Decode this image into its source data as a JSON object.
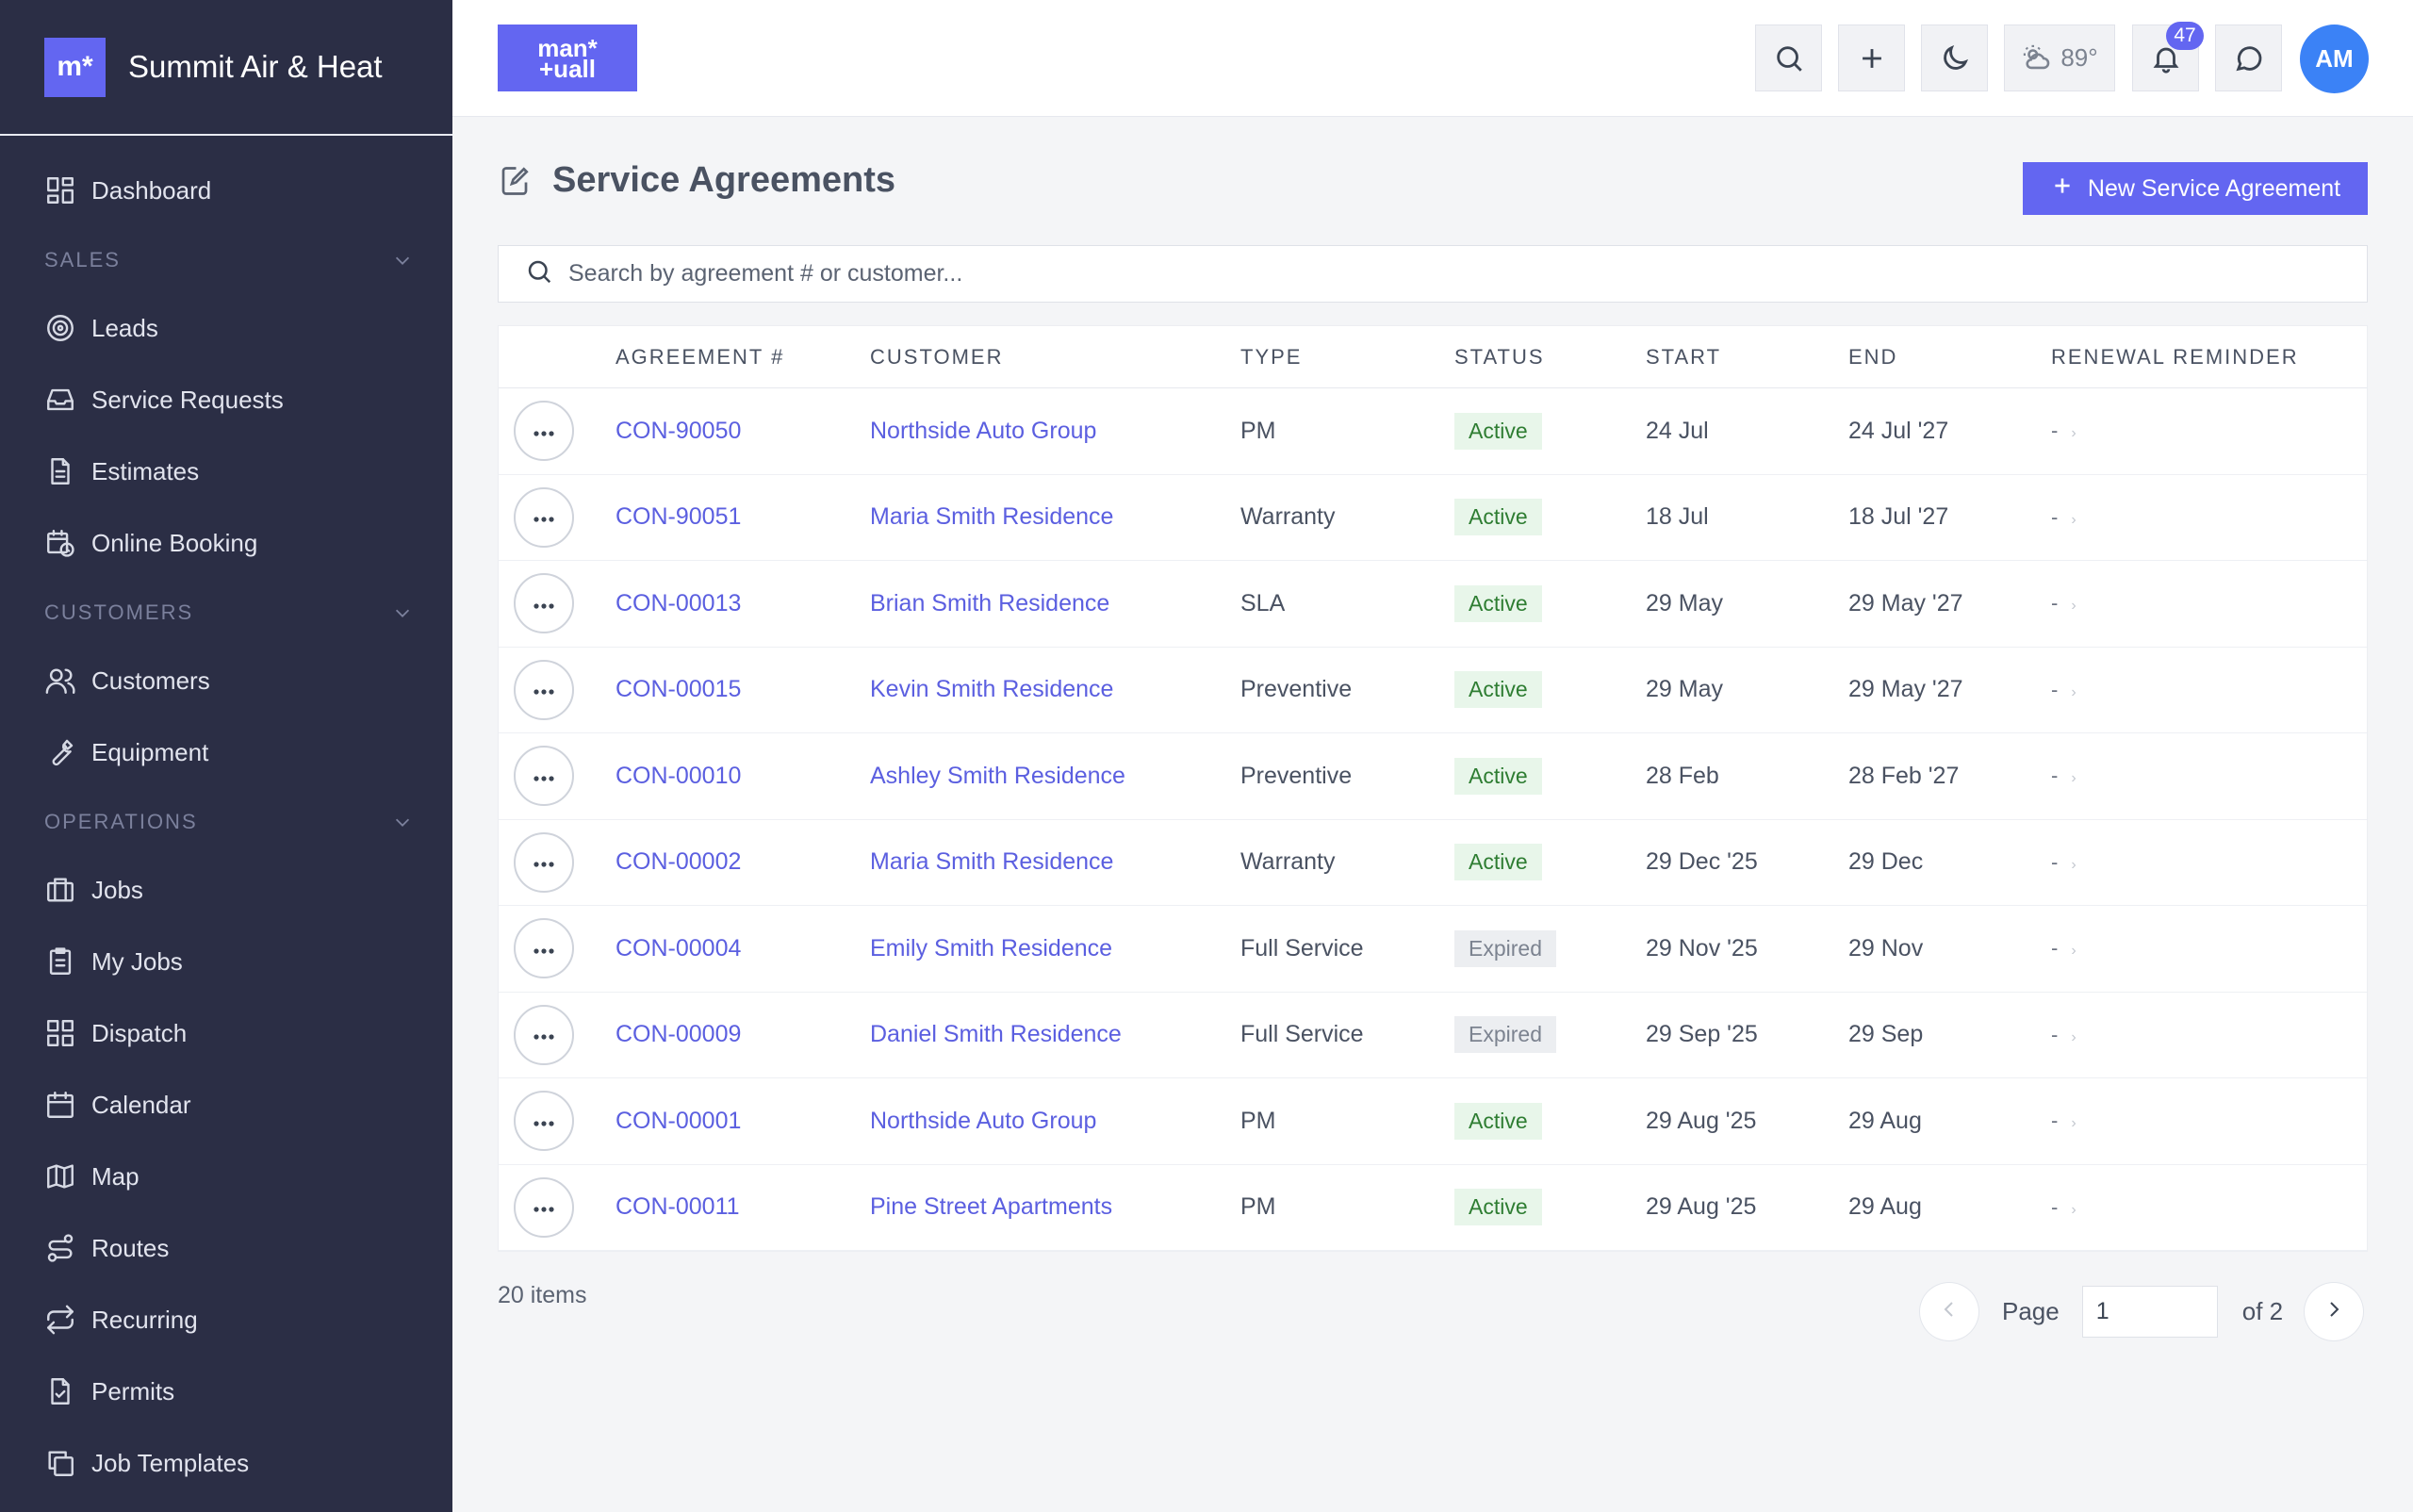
{
  "brand": {
    "logo": "m*",
    "name": "Summit Air & Heat"
  },
  "sidebar": {
    "top": [
      {
        "label": "Dashboard",
        "icon": "dashboard-icon"
      }
    ],
    "sections": [
      {
        "title": "SALES",
        "items": [
          {
            "label": "Leads",
            "icon": "target-icon"
          },
          {
            "label": "Service Requests",
            "icon": "inbox-icon"
          },
          {
            "label": "Estimates",
            "icon": "document-icon"
          },
          {
            "label": "Online Booking",
            "icon": "calendar-clock-icon"
          }
        ]
      },
      {
        "title": "CUSTOMERS",
        "items": [
          {
            "label": "Customers",
            "icon": "users-icon"
          },
          {
            "label": "Equipment",
            "icon": "wrench-icon"
          }
        ]
      },
      {
        "title": "OPERATIONS",
        "items": [
          {
            "label": "Jobs",
            "icon": "briefcase-icon"
          },
          {
            "label": "My Jobs",
            "icon": "clipboard-icon"
          },
          {
            "label": "Dispatch",
            "icon": "grid-icon"
          },
          {
            "label": "Calendar",
            "icon": "calendar-icon"
          },
          {
            "label": "Map",
            "icon": "map-icon"
          },
          {
            "label": "Routes",
            "icon": "route-icon"
          },
          {
            "label": "Recurring",
            "icon": "repeat-icon"
          },
          {
            "label": "Permits",
            "icon": "file-check-icon"
          },
          {
            "label": "Job Templates",
            "icon": "copy-icon"
          }
        ]
      }
    ]
  },
  "header": {
    "logo": "man*\n+uall",
    "weather": "89°",
    "notifications_count": "47",
    "avatar_initials": "AM"
  },
  "page": {
    "title": "Service Agreements",
    "new_button": "New Service Agreement",
    "search_placeholder": "Search by agreement # or customer..."
  },
  "table": {
    "columns": [
      "AGREEMENT #",
      "CUSTOMER",
      "TYPE",
      "STATUS",
      "START",
      "END",
      "RENEWAL REMINDER"
    ],
    "rows": [
      {
        "id": "CON-90050",
        "customer": "Northside Auto Group",
        "type": "PM",
        "status": "Active",
        "start": "24 Jul",
        "end": "24 Jul '27",
        "reminder": "-"
      },
      {
        "id": "CON-90051",
        "customer": "Maria Smith Residence",
        "type": "Warranty",
        "status": "Active",
        "start": "18 Jul",
        "end": "18 Jul '27",
        "reminder": "-"
      },
      {
        "id": "CON-00013",
        "customer": "Brian Smith Residence",
        "type": "SLA",
        "status": "Active",
        "start": "29 May",
        "end": "29 May '27",
        "reminder": "-"
      },
      {
        "id": "CON-00015",
        "customer": "Kevin Smith Residence",
        "type": "Preventive",
        "status": "Active",
        "start": "29 May",
        "end": "29 May '27",
        "reminder": "-"
      },
      {
        "id": "CON-00010",
        "customer": "Ashley Smith Residence",
        "type": "Preventive",
        "status": "Active",
        "start": "28 Feb",
        "end": "28 Feb '27",
        "reminder": "-"
      },
      {
        "id": "CON-00002",
        "customer": "Maria Smith Residence",
        "type": "Warranty",
        "status": "Active",
        "start": "29 Dec '25",
        "end": "29 Dec",
        "reminder": "-"
      },
      {
        "id": "CON-00004",
        "customer": "Emily Smith Residence",
        "type": "Full Service",
        "status": "Expired",
        "start": "29 Nov '25",
        "end": "29 Nov",
        "reminder": "-"
      },
      {
        "id": "CON-00009",
        "customer": "Daniel Smith Residence",
        "type": "Full Service",
        "status": "Expired",
        "start": "29 Sep '25",
        "end": "29 Sep",
        "reminder": "-"
      },
      {
        "id": "CON-00001",
        "customer": "Northside Auto Group",
        "type": "PM",
        "status": "Active",
        "start": "29 Aug '25",
        "end": "29 Aug",
        "reminder": "-"
      },
      {
        "id": "CON-00011",
        "customer": "Pine Street Apartments",
        "type": "PM",
        "status": "Active",
        "start": "29 Aug '25",
        "end": "29 Aug",
        "reminder": "-"
      }
    ]
  },
  "footer": {
    "items_count": "20 items",
    "page_label": "Page",
    "page_value": "1",
    "page_of": "of 2"
  },
  "colors": {
    "accent": "#6366f1",
    "sidebar": "#2b2e45",
    "active_bg": "#e8f6ea",
    "active_text": "#2e7d32",
    "expired_bg": "#eceef1"
  }
}
